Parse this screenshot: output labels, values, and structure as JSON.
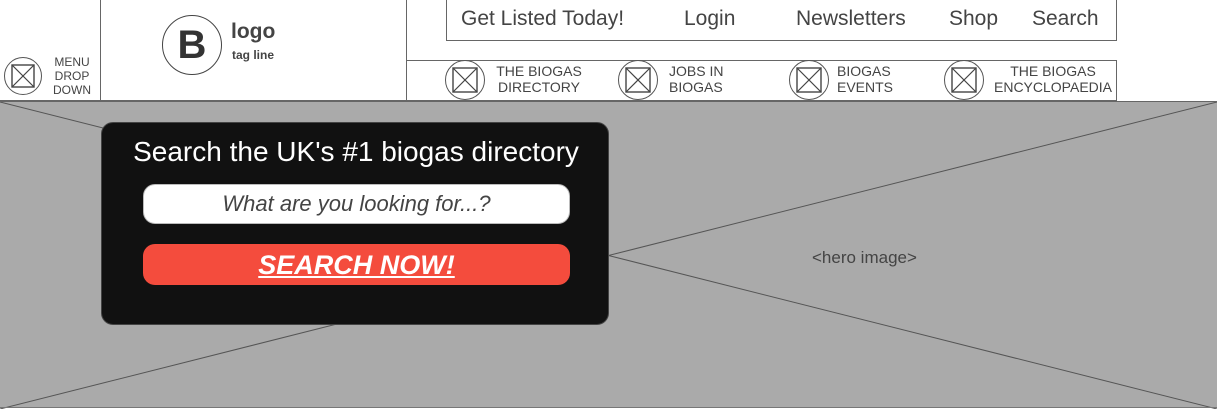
{
  "header": {
    "menu_lines": [
      "MENU",
      "DROP",
      "DOWN"
    ],
    "logo": {
      "letter": "B",
      "title": "logo",
      "tagline": "tag line"
    }
  },
  "top_nav": {
    "items": [
      "Get Listed Today!",
      "Login",
      "Newsletters",
      "Shop",
      "Search"
    ]
  },
  "section_nav": {
    "items": [
      {
        "line1": "THE BIOGAS",
        "line2": "DIRECTORY"
      },
      {
        "line1": "JOBS IN",
        "line2": "BIOGAS"
      },
      {
        "line1": "BIOGAS",
        "line2": "EVENTS"
      },
      {
        "line1": "THE BIOGAS",
        "line2": "ENCYCLOPAEDIA"
      }
    ]
  },
  "hero": {
    "label": "<hero image>",
    "search": {
      "title": "Search the UK's #1 biogas directory",
      "placeholder": "What are you looking for...?",
      "button": "SEARCH NOW!"
    }
  },
  "colors": {
    "accent": "#f44c3d",
    "card": "#111111",
    "hero_bg": "#aaaaaa"
  },
  "icons": [
    "placeholder-icon"
  ]
}
